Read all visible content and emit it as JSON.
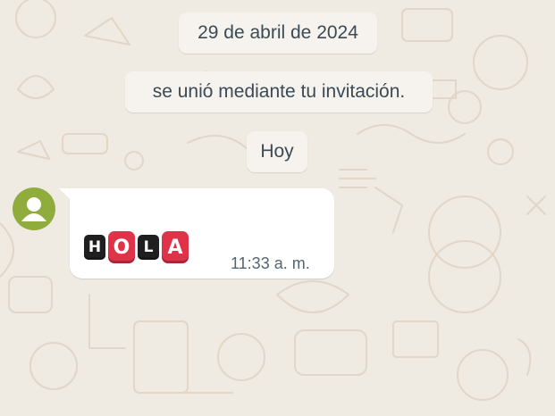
{
  "chat": {
    "date_separator": "29 de abril de 2024",
    "system_message": "se unió mediante tu invitación.",
    "today_separator": "Hoy"
  },
  "message": {
    "letters": [
      {
        "char": "H",
        "style": "dark"
      },
      {
        "char": "O",
        "style": "red"
      },
      {
        "char": "L",
        "style": "dark"
      },
      {
        "char": "A",
        "style": "red"
      }
    ],
    "time": "11:33 a. m."
  },
  "colors": {
    "background": "#efeae2",
    "bubble": "#ffffff",
    "avatar": "#8fac3d",
    "tile_dark": "#1f1f1f",
    "tile_red": "#e0334a"
  }
}
